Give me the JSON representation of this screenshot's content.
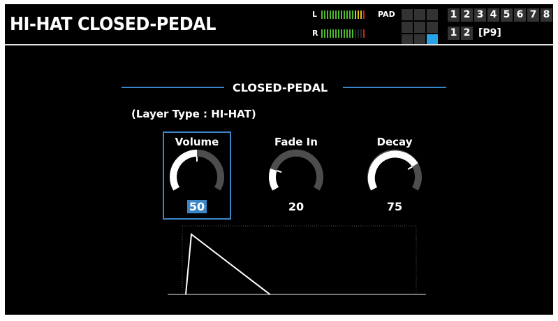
{
  "header": {
    "title": "HI-HAT CLOSED-PEDAL",
    "meter_l_label": "L",
    "meter_r_label": "R",
    "pad_label": "PAD",
    "layer_numbers": [
      "1",
      "2",
      "3",
      "4",
      "5",
      "6",
      "7",
      "8"
    ],
    "sub_numbers": [
      "1",
      "2"
    ],
    "kit_id": "[P9]"
  },
  "section": {
    "title": "CLOSED-PEDAL",
    "layer_type": "(Layer Type : HI-HAT)"
  },
  "params": [
    {
      "label": "Volume",
      "value": "50",
      "level": 0.5,
      "selected": true
    },
    {
      "label": "Fade In",
      "value": "20",
      "level": 0.2,
      "selected": false
    },
    {
      "label": "Decay",
      "value": "75",
      "level": 0.75,
      "selected": false
    }
  ],
  "colors": {
    "background": "#000000",
    "accent": "#3a86c8",
    "pad_active": "#29a3e8",
    "meter_green": "#4fb82f",
    "meter_yellow": "#e2c020",
    "meter_red": "#d02020"
  }
}
